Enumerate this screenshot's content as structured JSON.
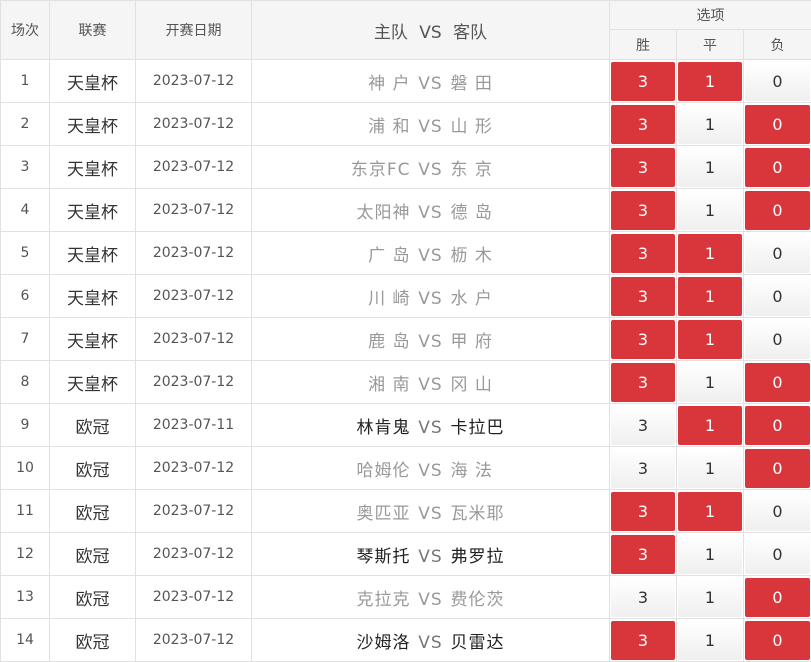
{
  "header": {
    "col_index": "场次",
    "col_league": "联赛",
    "col_date": "开赛日期",
    "col_home": "主队",
    "col_vs": "VS",
    "col_away": "客队",
    "col_options": "选项",
    "opt_win": "胜",
    "opt_draw": "平",
    "opt_lose": "负"
  },
  "colors": {
    "selected": "#d9363b",
    "border": "#e1e1e1",
    "header_bg": "#f5f5f5"
  },
  "rows": [
    {
      "index": "1",
      "league": "天皇杯",
      "date": "2023-07-12",
      "home": "神 户",
      "vs": "VS",
      "away": "磐 田",
      "win": "3",
      "draw": "1",
      "lose": "0",
      "sel": [
        true,
        true,
        false
      ],
      "style": "dim"
    },
    {
      "index": "2",
      "league": "天皇杯",
      "date": "2023-07-12",
      "home": "浦 和",
      "vs": "VS",
      "away": "山 形",
      "win": "3",
      "draw": "1",
      "lose": "0",
      "sel": [
        true,
        false,
        true
      ],
      "style": "dim"
    },
    {
      "index": "3",
      "league": "天皇杯",
      "date": "2023-07-12",
      "home": "东京FC",
      "vs": "VS",
      "away": "东 京",
      "win": "3",
      "draw": "1",
      "lose": "0",
      "sel": [
        true,
        false,
        true
      ],
      "style": "dim"
    },
    {
      "index": "4",
      "league": "天皇杯",
      "date": "2023-07-12",
      "home": "太阳神",
      "vs": "VS",
      "away": "德 岛",
      "win": "3",
      "draw": "1",
      "lose": "0",
      "sel": [
        true,
        false,
        true
      ],
      "style": "dim"
    },
    {
      "index": "5",
      "league": "天皇杯",
      "date": "2023-07-12",
      "home": "广 岛",
      "vs": "VS",
      "away": "枥 木",
      "win": "3",
      "draw": "1",
      "lose": "0",
      "sel": [
        true,
        true,
        false
      ],
      "style": "dim"
    },
    {
      "index": "6",
      "league": "天皇杯",
      "date": "2023-07-12",
      "home": "川 崎",
      "vs": "VS",
      "away": "水 户",
      "win": "3",
      "draw": "1",
      "lose": "0",
      "sel": [
        true,
        true,
        false
      ],
      "style": "dim"
    },
    {
      "index": "7",
      "league": "天皇杯",
      "date": "2023-07-12",
      "home": "鹿 岛",
      "vs": "VS",
      "away": "甲 府",
      "win": "3",
      "draw": "1",
      "lose": "0",
      "sel": [
        true,
        true,
        false
      ],
      "style": "dim"
    },
    {
      "index": "8",
      "league": "天皇杯",
      "date": "2023-07-12",
      "home": "湘 南",
      "vs": "VS",
      "away": "冈 山",
      "win": "3",
      "draw": "1",
      "lose": "0",
      "sel": [
        true,
        false,
        true
      ],
      "style": "dim"
    },
    {
      "index": "9",
      "league": "欧冠",
      "date": "2023-07-11",
      "home": "林肯鬼",
      "vs": "VS",
      "away": "卡拉巴",
      "win": "3",
      "draw": "1",
      "lose": "0",
      "sel": [
        false,
        true,
        true
      ],
      "style": "bold"
    },
    {
      "index": "10",
      "league": "欧冠",
      "date": "2023-07-12",
      "home": "哈姆伦",
      "vs": "VS",
      "away": "海 法",
      "win": "3",
      "draw": "1",
      "lose": "0",
      "sel": [
        false,
        false,
        true
      ],
      "style": "dim"
    },
    {
      "index": "11",
      "league": "欧冠",
      "date": "2023-07-12",
      "home": "奥匹亚",
      "vs": "VS",
      "away": "瓦米耶",
      "win": "3",
      "draw": "1",
      "lose": "0",
      "sel": [
        true,
        true,
        false
      ],
      "style": "dim"
    },
    {
      "index": "12",
      "league": "欧冠",
      "date": "2023-07-12",
      "home": "琴斯托",
      "vs": "VS",
      "away": "弗罗拉",
      "win": "3",
      "draw": "1",
      "lose": "0",
      "sel": [
        true,
        false,
        false
      ],
      "style": "bold"
    },
    {
      "index": "13",
      "league": "欧冠",
      "date": "2023-07-12",
      "home": "克拉克",
      "vs": "VS",
      "away": "费伦茨",
      "win": "3",
      "draw": "1",
      "lose": "0",
      "sel": [
        false,
        false,
        true
      ],
      "style": "dim"
    },
    {
      "index": "14",
      "league": "欧冠",
      "date": "2023-07-12",
      "home": "沙姆洛",
      "vs": "VS",
      "away": "贝雷达",
      "win": "3",
      "draw": "1",
      "lose": "0",
      "sel": [
        true,
        false,
        true
      ],
      "style": "bold"
    }
  ]
}
